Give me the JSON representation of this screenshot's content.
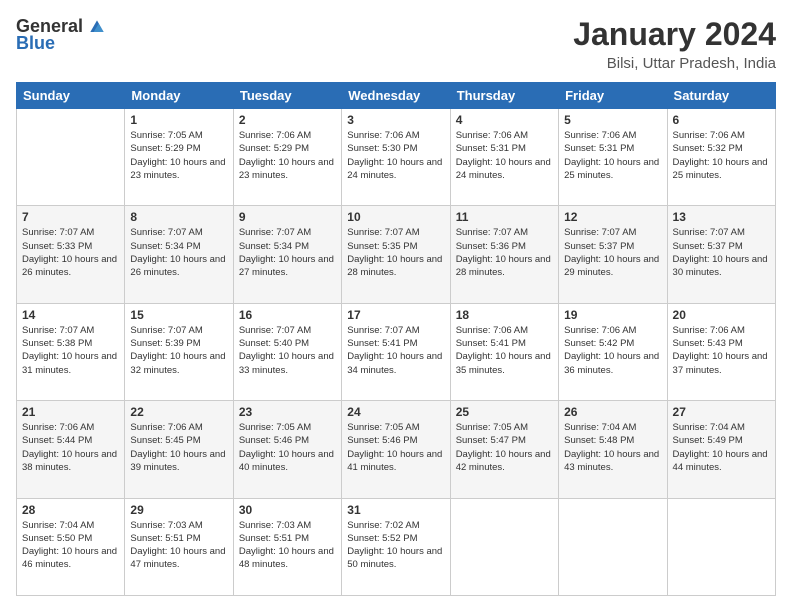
{
  "logo": {
    "general": "General",
    "blue": "Blue"
  },
  "header": {
    "title": "January 2024",
    "subtitle": "Bilsi, Uttar Pradesh, India"
  },
  "weekdays": [
    "Sunday",
    "Monday",
    "Tuesday",
    "Wednesday",
    "Thursday",
    "Friday",
    "Saturday"
  ],
  "weeks": [
    [
      {
        "day": "",
        "sunrise": "",
        "sunset": "",
        "daylight": ""
      },
      {
        "day": "1",
        "sunrise": "Sunrise: 7:05 AM",
        "sunset": "Sunset: 5:29 PM",
        "daylight": "Daylight: 10 hours and 23 minutes."
      },
      {
        "day": "2",
        "sunrise": "Sunrise: 7:06 AM",
        "sunset": "Sunset: 5:29 PM",
        "daylight": "Daylight: 10 hours and 23 minutes."
      },
      {
        "day": "3",
        "sunrise": "Sunrise: 7:06 AM",
        "sunset": "Sunset: 5:30 PM",
        "daylight": "Daylight: 10 hours and 24 minutes."
      },
      {
        "day": "4",
        "sunrise": "Sunrise: 7:06 AM",
        "sunset": "Sunset: 5:31 PM",
        "daylight": "Daylight: 10 hours and 24 minutes."
      },
      {
        "day": "5",
        "sunrise": "Sunrise: 7:06 AM",
        "sunset": "Sunset: 5:31 PM",
        "daylight": "Daylight: 10 hours and 25 minutes."
      },
      {
        "day": "6",
        "sunrise": "Sunrise: 7:06 AM",
        "sunset": "Sunset: 5:32 PM",
        "daylight": "Daylight: 10 hours and 25 minutes."
      }
    ],
    [
      {
        "day": "7",
        "sunrise": "Sunrise: 7:07 AM",
        "sunset": "Sunset: 5:33 PM",
        "daylight": "Daylight: 10 hours and 26 minutes."
      },
      {
        "day": "8",
        "sunrise": "Sunrise: 7:07 AM",
        "sunset": "Sunset: 5:34 PM",
        "daylight": "Daylight: 10 hours and 26 minutes."
      },
      {
        "day": "9",
        "sunrise": "Sunrise: 7:07 AM",
        "sunset": "Sunset: 5:34 PM",
        "daylight": "Daylight: 10 hours and 27 minutes."
      },
      {
        "day": "10",
        "sunrise": "Sunrise: 7:07 AM",
        "sunset": "Sunset: 5:35 PM",
        "daylight": "Daylight: 10 hours and 28 minutes."
      },
      {
        "day": "11",
        "sunrise": "Sunrise: 7:07 AM",
        "sunset": "Sunset: 5:36 PM",
        "daylight": "Daylight: 10 hours and 28 minutes."
      },
      {
        "day": "12",
        "sunrise": "Sunrise: 7:07 AM",
        "sunset": "Sunset: 5:37 PM",
        "daylight": "Daylight: 10 hours and 29 minutes."
      },
      {
        "day": "13",
        "sunrise": "Sunrise: 7:07 AM",
        "sunset": "Sunset: 5:37 PM",
        "daylight": "Daylight: 10 hours and 30 minutes."
      }
    ],
    [
      {
        "day": "14",
        "sunrise": "Sunrise: 7:07 AM",
        "sunset": "Sunset: 5:38 PM",
        "daylight": "Daylight: 10 hours and 31 minutes."
      },
      {
        "day": "15",
        "sunrise": "Sunrise: 7:07 AM",
        "sunset": "Sunset: 5:39 PM",
        "daylight": "Daylight: 10 hours and 32 minutes."
      },
      {
        "day": "16",
        "sunrise": "Sunrise: 7:07 AM",
        "sunset": "Sunset: 5:40 PM",
        "daylight": "Daylight: 10 hours and 33 minutes."
      },
      {
        "day": "17",
        "sunrise": "Sunrise: 7:07 AM",
        "sunset": "Sunset: 5:41 PM",
        "daylight": "Daylight: 10 hours and 34 minutes."
      },
      {
        "day": "18",
        "sunrise": "Sunrise: 7:06 AM",
        "sunset": "Sunset: 5:41 PM",
        "daylight": "Daylight: 10 hours and 35 minutes."
      },
      {
        "day": "19",
        "sunrise": "Sunrise: 7:06 AM",
        "sunset": "Sunset: 5:42 PM",
        "daylight": "Daylight: 10 hours and 36 minutes."
      },
      {
        "day": "20",
        "sunrise": "Sunrise: 7:06 AM",
        "sunset": "Sunset: 5:43 PM",
        "daylight": "Daylight: 10 hours and 37 minutes."
      }
    ],
    [
      {
        "day": "21",
        "sunrise": "Sunrise: 7:06 AM",
        "sunset": "Sunset: 5:44 PM",
        "daylight": "Daylight: 10 hours and 38 minutes."
      },
      {
        "day": "22",
        "sunrise": "Sunrise: 7:06 AM",
        "sunset": "Sunset: 5:45 PM",
        "daylight": "Daylight: 10 hours and 39 minutes."
      },
      {
        "day": "23",
        "sunrise": "Sunrise: 7:05 AM",
        "sunset": "Sunset: 5:46 PM",
        "daylight": "Daylight: 10 hours and 40 minutes."
      },
      {
        "day": "24",
        "sunrise": "Sunrise: 7:05 AM",
        "sunset": "Sunset: 5:46 PM",
        "daylight": "Daylight: 10 hours and 41 minutes."
      },
      {
        "day": "25",
        "sunrise": "Sunrise: 7:05 AM",
        "sunset": "Sunset: 5:47 PM",
        "daylight": "Daylight: 10 hours and 42 minutes."
      },
      {
        "day": "26",
        "sunrise": "Sunrise: 7:04 AM",
        "sunset": "Sunset: 5:48 PM",
        "daylight": "Daylight: 10 hours and 43 minutes."
      },
      {
        "day": "27",
        "sunrise": "Sunrise: 7:04 AM",
        "sunset": "Sunset: 5:49 PM",
        "daylight": "Daylight: 10 hours and 44 minutes."
      }
    ],
    [
      {
        "day": "28",
        "sunrise": "Sunrise: 7:04 AM",
        "sunset": "Sunset: 5:50 PM",
        "daylight": "Daylight: 10 hours and 46 minutes."
      },
      {
        "day": "29",
        "sunrise": "Sunrise: 7:03 AM",
        "sunset": "Sunset: 5:51 PM",
        "daylight": "Daylight: 10 hours and 47 minutes."
      },
      {
        "day": "30",
        "sunrise": "Sunrise: 7:03 AM",
        "sunset": "Sunset: 5:51 PM",
        "daylight": "Daylight: 10 hours and 48 minutes."
      },
      {
        "day": "31",
        "sunrise": "Sunrise: 7:02 AM",
        "sunset": "Sunset: 5:52 PM",
        "daylight": "Daylight: 10 hours and 50 minutes."
      },
      {
        "day": "",
        "sunrise": "",
        "sunset": "",
        "daylight": ""
      },
      {
        "day": "",
        "sunrise": "",
        "sunset": "",
        "daylight": ""
      },
      {
        "day": "",
        "sunrise": "",
        "sunset": "",
        "daylight": ""
      }
    ]
  ]
}
